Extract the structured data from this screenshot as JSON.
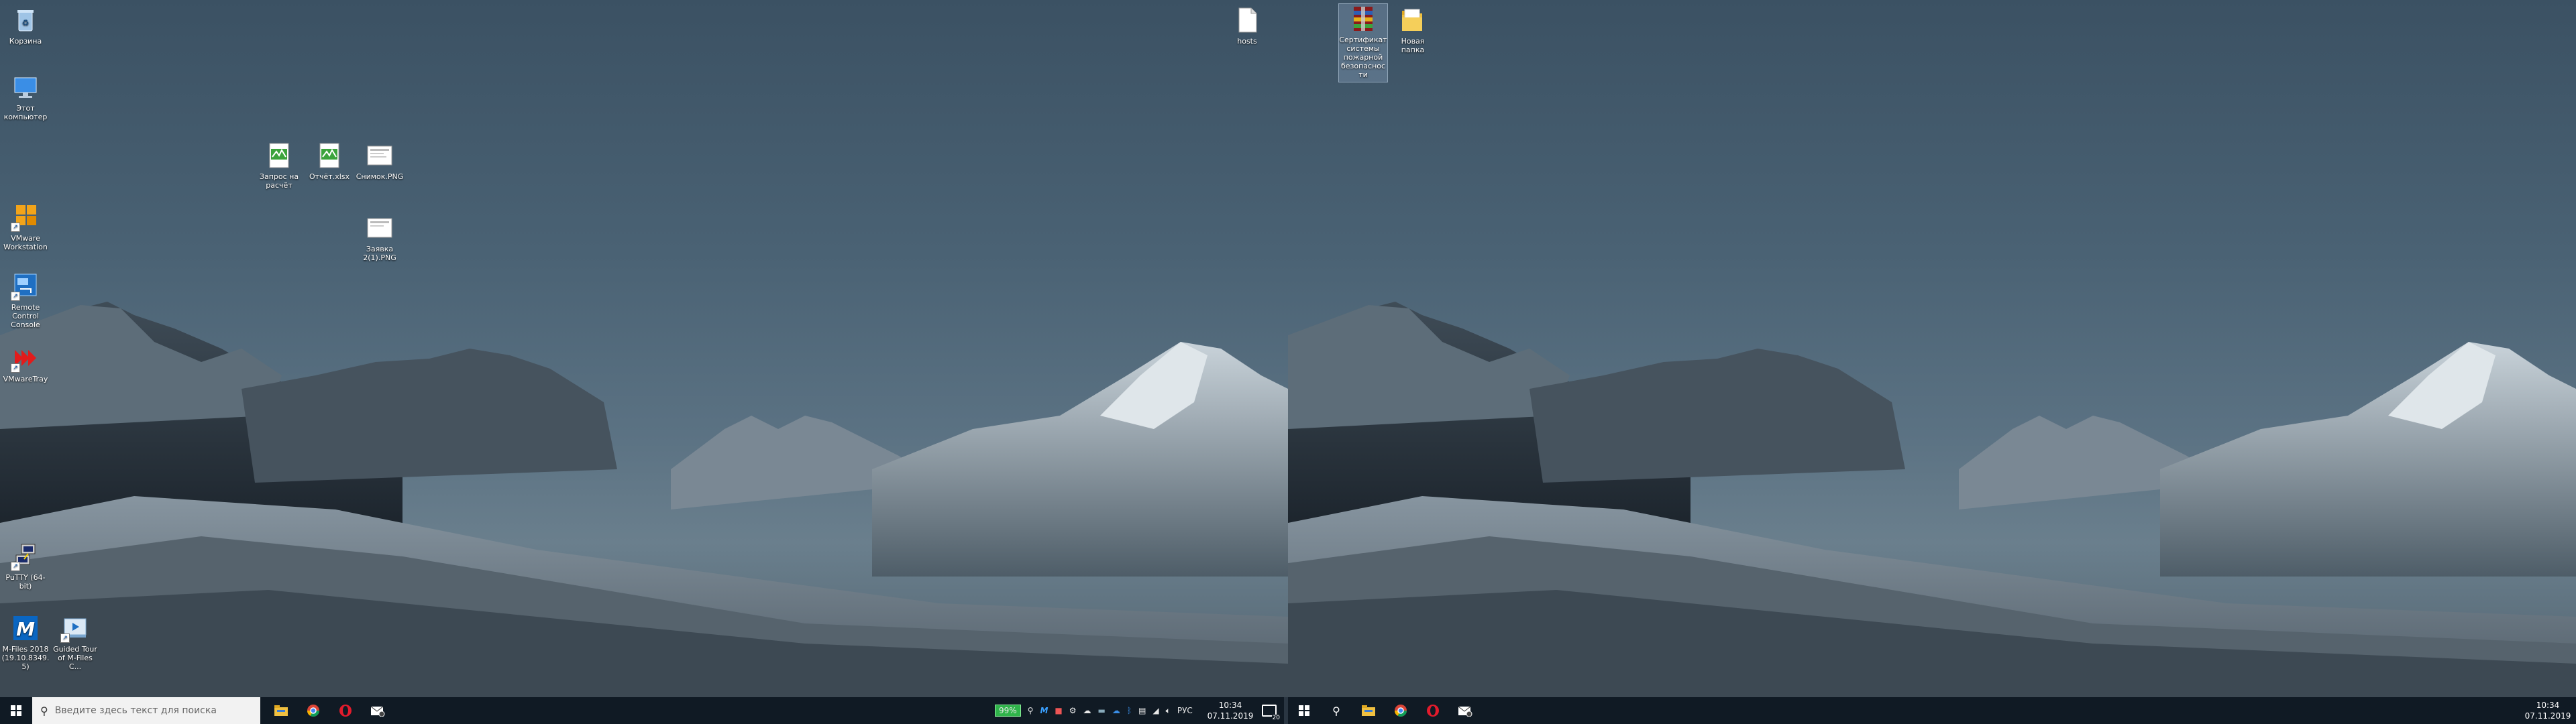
{
  "left_desktop": {
    "icons": [
      {
        "label": "Корзина",
        "icon": "recycle-bin-icon"
      },
      {
        "label": "Этот компьютер",
        "icon": "computer-icon"
      },
      {
        "label": "VMware Workstation",
        "icon": "vmware-icon"
      },
      {
        "label": "Remote Control Console",
        "icon": "remote-console-icon"
      },
      {
        "label": "VMwareTray",
        "icon": "vmware-tray-icon"
      },
      {
        "label": "PuTTY (64-bit)",
        "icon": "putty-icon"
      },
      {
        "label": "M-Files 2018 (19.10.8349.5)",
        "icon": "m-files-icon"
      },
      {
        "label": "Guided Tour of M-Files C...",
        "icon": "guided-tour-icon"
      },
      {
        "label": "Запрос на расчёт",
        "icon": "document-icon"
      },
      {
        "label": "Отчёт.xlsx",
        "icon": "document-icon"
      },
      {
        "label": "Снимок.PNG",
        "icon": "image-icon"
      },
      {
        "label": "Заявка 2(1).PNG",
        "icon": "image-icon"
      },
      {
        "label": "hosts",
        "icon": "file-icon"
      }
    ]
  },
  "right_desktop": {
    "icons": [
      {
        "label": "Сертификат системы пожарной безопасности",
        "icon": "archive-icon"
      },
      {
        "label": "Новая папка",
        "icon": "folder-icon"
      }
    ]
  },
  "taskbar_left": {
    "start_icon": "windows-start-icon",
    "search_placeholder": "Введите здесь текст для поиска",
    "pinned": [
      "file-explorer-icon",
      "chrome-icon",
      "opera-icon",
      "mail-icon"
    ],
    "battery": "99%",
    "language": "РУС",
    "time": "10:34",
    "date": "07.11.2019",
    "notifications": "20"
  },
  "taskbar_right": {
    "start_icon": "windows-start-icon",
    "pinned": [
      "search-icon",
      "file-explorer-icon",
      "chrome-icon",
      "opera-icon",
      "mail-icon"
    ],
    "time": "10:34",
    "date": "07.11.2019"
  }
}
